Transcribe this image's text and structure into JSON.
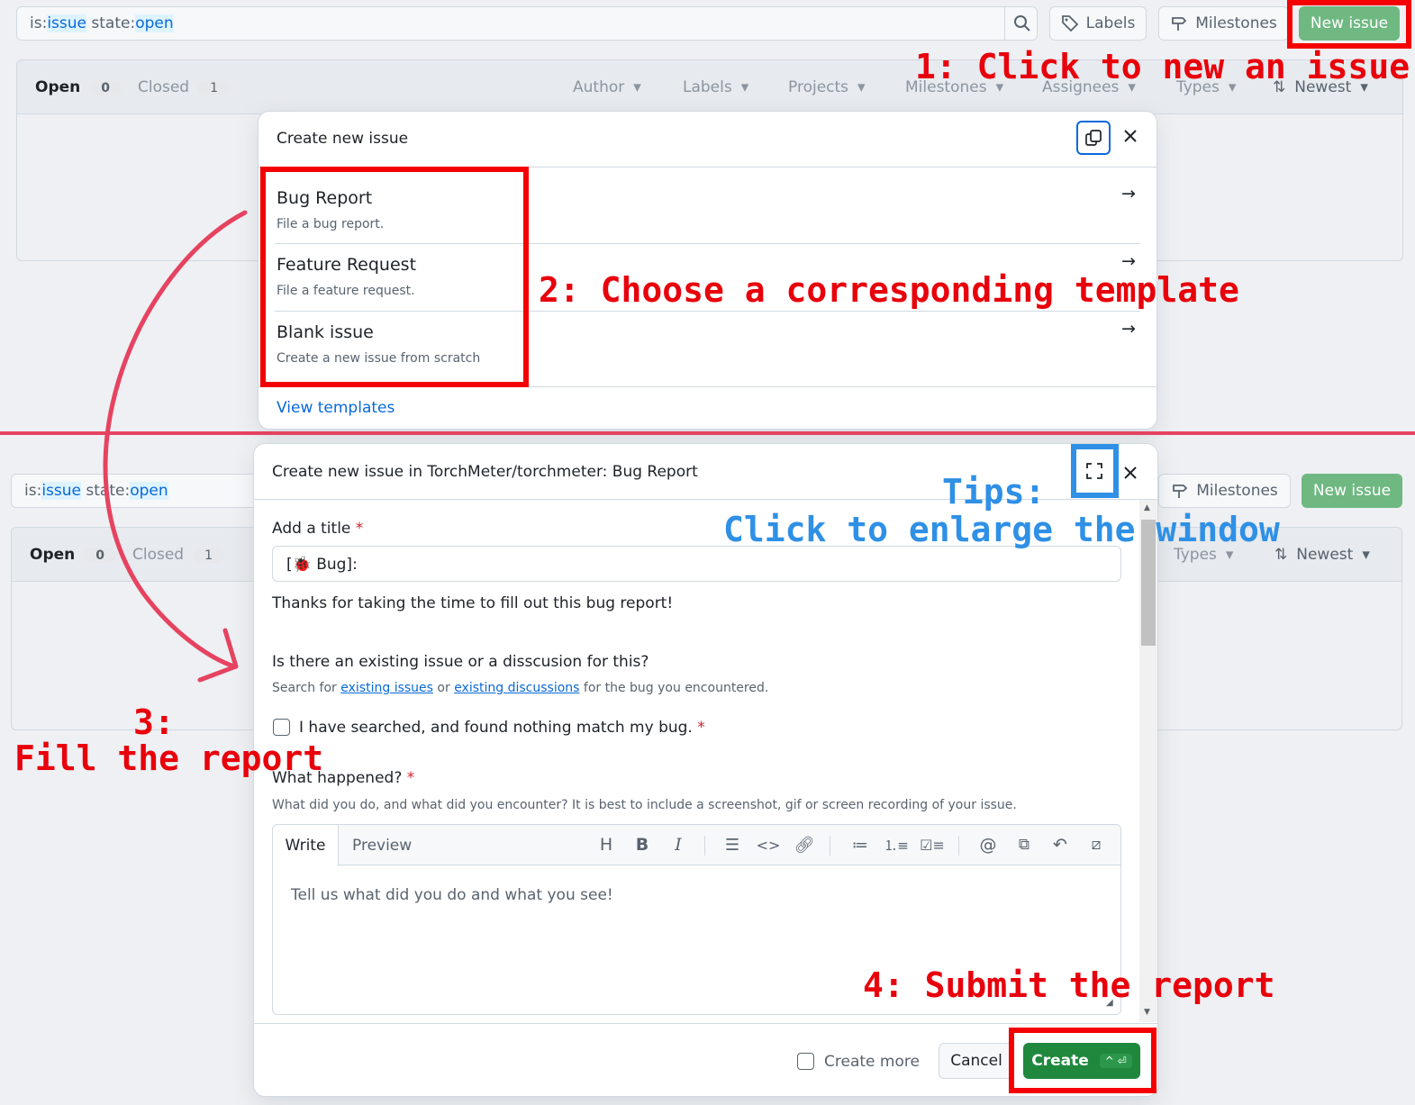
{
  "top": {
    "search": {
      "prefix1": "is:",
      "term1": "issue",
      "prefix2": " state:",
      "term2": "open"
    },
    "labels_btn": "Labels",
    "milestones_btn": "Milestones",
    "new_issue_btn": "New issue",
    "tabs": {
      "open": "Open",
      "open_count": "0",
      "closed": "Closed",
      "closed_count": "1"
    },
    "filters": [
      "Author",
      "Labels",
      "Projects",
      "Milestones",
      "Assignees",
      "Types"
    ],
    "sort": "Newest"
  },
  "dialog1": {
    "title": "Create new issue",
    "templates": [
      {
        "name": "Bug Report",
        "desc": "File a bug report."
      },
      {
        "name": "Feature Request",
        "desc": "File a feature request."
      },
      {
        "name": "Blank issue",
        "desc": "Create a new issue from scratch"
      }
    ],
    "view_templates": "View templates"
  },
  "bottom": {
    "search": {
      "prefix1": "is:",
      "term1": "issue",
      "prefix2": " state:",
      "term2": "open"
    },
    "milestones_btn": "Milestones",
    "new_issue_btn": "New issue",
    "tabs": {
      "open": "Open",
      "open_count": "0",
      "closed": "Closed",
      "closed_count": "1"
    },
    "types": "Types",
    "sort": "Newest"
  },
  "dialog2": {
    "title": "Create new issue in TorchMeter/torchmeter: Bug Report",
    "add_title_label": "Add a title",
    "required": "*",
    "title_value": "[🐞 Bug]:",
    "thanks": "Thanks for taking the time to fill out this bug report!",
    "q_existing": "Is there an existing issue or a disscusion for this?",
    "search_for": "Search for",
    "existing_issues": "existing issues",
    "or": "or",
    "existing_discussions": "existing discussions",
    "search_tail": "for the bug you encountered.",
    "checkbox_label": "I have searched, and found nothing match my bug.",
    "what_happened": "What happened?",
    "what_desc": "What did you do, and what did you encounter? It is best to include a screenshot, gif or screen recording of your issue.",
    "tab_write": "Write",
    "tab_preview": "Preview",
    "editor_placeholder": "Tell us what did you do and what you see!",
    "create_more": "Create more",
    "cancel": "Cancel",
    "create": "Create",
    "shortcut": "^ ⏎"
  },
  "annotations": {
    "step1": "1: Click to new an issue",
    "step2": "2: Choose a corresponding template",
    "step3_num": "3:",
    "step3_text": "Fill the report",
    "step4": "4: Submit the report",
    "tips_title": "Tips:",
    "tips_text": "Click to enlarge the window"
  },
  "colors": {
    "red": "#e8000b",
    "blue": "#2f90e5",
    "green": "#1f883d",
    "link": "#0969da"
  },
  "icons": [
    "search-icon",
    "tag-icon",
    "milestone-icon",
    "chevron-down-icon",
    "sort-icon",
    "duplicate-icon",
    "close-icon",
    "arrow-right-icon",
    "fullscreen-icon",
    "heading-icon",
    "bold-icon",
    "italic-icon",
    "quote-icon",
    "code-icon",
    "link-icon",
    "bullet-list-icon",
    "numbered-list-icon",
    "task-list-icon",
    "mention-icon",
    "reference-icon",
    "reply-icon",
    "slash-icon"
  ]
}
